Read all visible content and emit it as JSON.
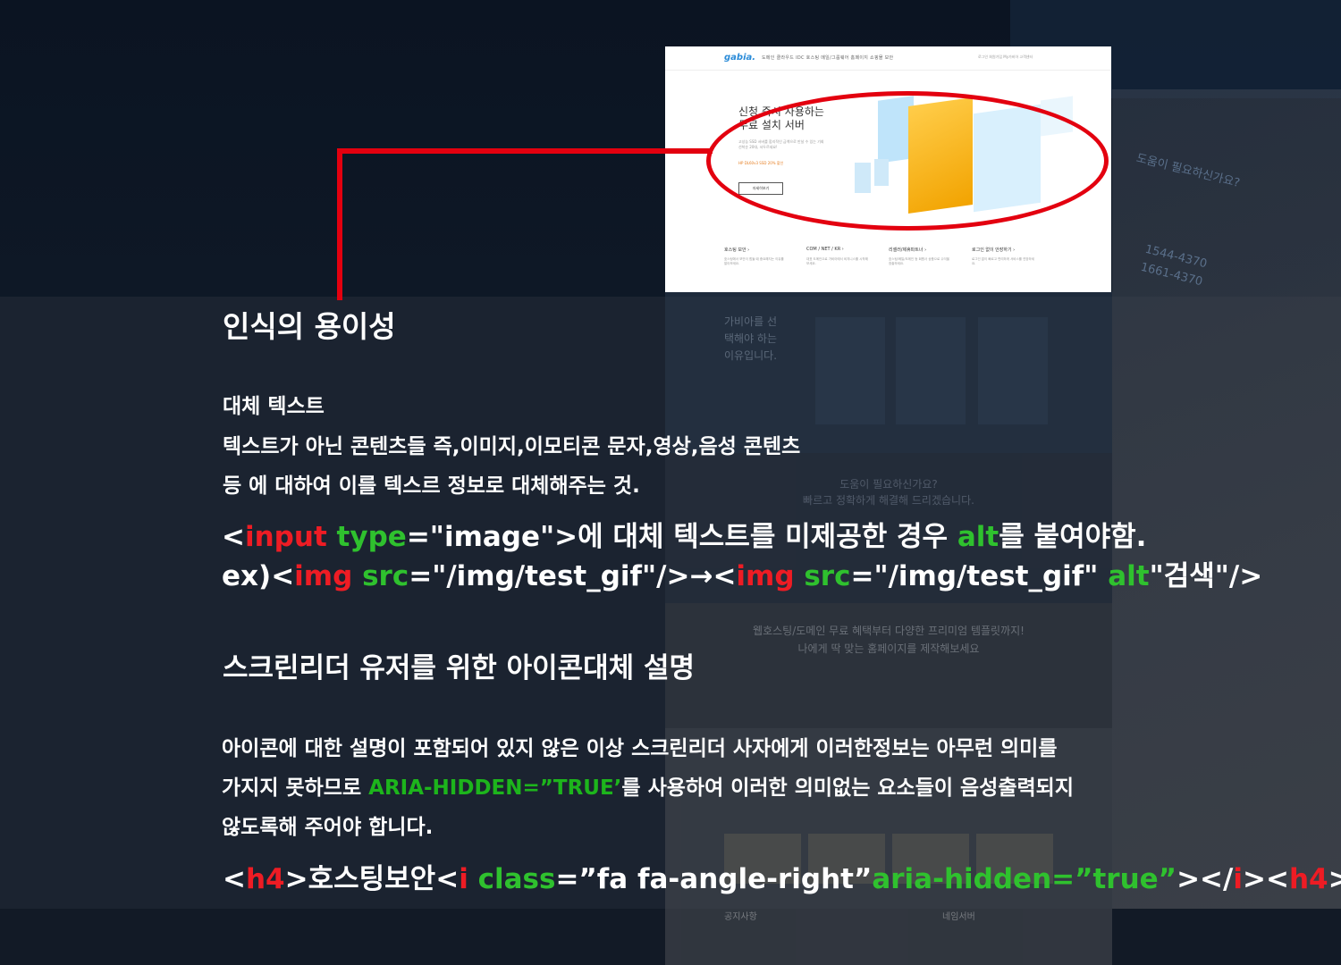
{
  "background_site": {
    "why_text": "가비아를 선택해야 하는 이유입니다.",
    "help_question": "도움이 필요하신가요?",
    "help_sub": "빠르고 정확하게 해결해 드리겠습니다.",
    "template_title": "웹호스팅/도메인 무료 혜택부터 다양한 프리미엄 템플릿까지!",
    "template_sub": "나에게 딱 맞는 홈페이지를 제작해보세요",
    "notice": "공지사항",
    "recent": "네임서버",
    "phone1": "1544-4370",
    "phone2": "1661-4370"
  },
  "screenshot": {
    "logo": "gabia.",
    "nav": "도메인   클라우드   IDC   호스팅   메일/그룹웨어   홈페이지   쇼핑몰   보안",
    "nav_right": "로그인   회원가입   My가비아   고객센터",
    "headline_1": "신청 즉시 사용하는",
    "headline_2": "무료 설치 서버",
    "sub_1": "고성능 SSD 서버를 합리적인 금액으로 만날 수 있는 기회",
    "sub_2": "선착순 20대, 서두르세요!",
    "promo": "HP DL60v3 SSD 20% 할인",
    "more": "자세히보기",
    "services": [
      {
        "title": "호스팅 보안  ›",
        "desc": "호스팅에서 보안이 힘들 때 중요해지는 이유를 알아보세요."
      },
      {
        "title": "COM / NET / KR  ›",
        "desc": "대표 도메인으로 가비아에서 비지니스를 시작해보세요."
      },
      {
        "title": "리셀러/제휴파트너  ›",
        "desc": "호스팅/메일/도메인 등 회원사 상품으로 수익을 창출하세요."
      },
      {
        "title": "로그인 없이 안장하기  ›",
        "desc": "로그인 없이 빠르고 편리하게 서비스를 연장하세요."
      }
    ]
  },
  "content": {
    "title": "인식의 용이성",
    "alt_heading": "대체 텍스트",
    "alt_line1": "텍스트가 아닌 콘텐츠들 즉,이미지,이모티콘 문자,영상,음성 콘텐츠",
    "alt_line2": "등 에 대하여 이를 텍스르 정보로 대체해주는 것.",
    "code1": {
      "lt": "<",
      "tag": "input",
      "attr": " type",
      "eq": "=\"image\">",
      "text": "에 대체 텍스트를 미제공한 경우 ",
      "alt": "alt",
      "tail": "를 붙여야함."
    },
    "code2": {
      "pre": "ex)<",
      "tag1": "img",
      "attr1": " src",
      "val1": "=\"/img/test_gif\"/>→<",
      "tag2": "img",
      "attr2": " src",
      "val2": "=\"/img/test_gif\" ",
      "alt": "alt",
      "val3": "\"검색\"/>"
    },
    "icon_heading": "스크린리더 유저를 위한 아이콘대체 설명",
    "icon_line1": "아이콘에 대한 설명이 포함되어 있지 않은 이상 스크린리더 사자에게 이러한정보는 아무런 의미를",
    "icon_line2_a": "가지지 못하므로 ",
    "icon_line2_b": "ARIA-HIDDEN=”TRUE’",
    "icon_line2_c": "를 사용하여 이러한 의미없는 요소들이 음성출력되지",
    "icon_line3": "않도록해 주어야 합니다.",
    "code3": {
      "lt": "<",
      "h4a": "h4",
      "mid1": ">호스팅보안<",
      "i": "i",
      "cls": " class",
      "val": "=”fa fa-angle-right”",
      "aria": "aria-hidden=”true”",
      "mid2": "></",
      "i2": "i",
      "mid3": "><",
      "h4b": "h4",
      "gt": ">"
    }
  },
  "colors": {
    "highlight_red": "#ee1c24",
    "highlight_green": "#2fc12e",
    "panel": "#1b2330"
  }
}
